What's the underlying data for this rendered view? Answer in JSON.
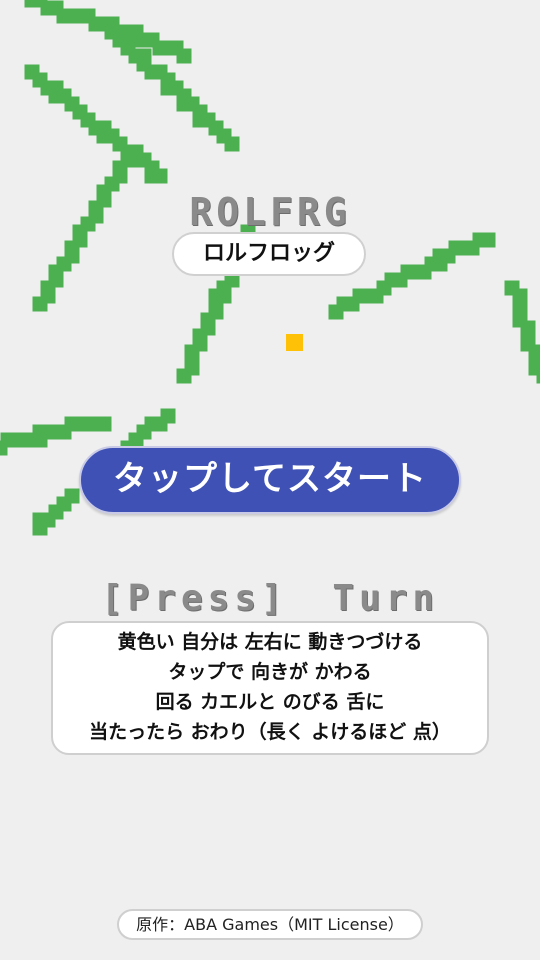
{
  "colors": {
    "background": "#efefef",
    "tongue": "#4caf50",
    "frog": "#ffc107",
    "start_button": "#3f51b5",
    "pixel_text": "#8a8a8a"
  },
  "title": {
    "english": "ROLFRG",
    "japanese": "ロルフロッグ"
  },
  "start_button": {
    "label": "タップしてスタート"
  },
  "controls": {
    "label": "[Press] Turn"
  },
  "instructions": {
    "lines": [
      "黄色い 自分は 左右に 動きつづける",
      "タップで 向きが かわる",
      "回る カエルと のびる 舌に",
      "当たったら おわり（長く よけるほど 点）"
    ]
  },
  "credit": {
    "text": "原作：ABA Games（MIT License）"
  }
}
